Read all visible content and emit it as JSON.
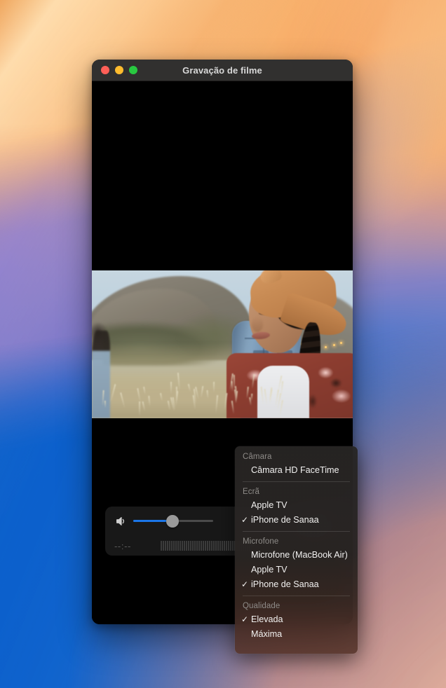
{
  "window": {
    "title": "Gravação de filme",
    "traffic_lights": [
      {
        "name": "close",
        "color": "#ff5f57"
      },
      {
        "name": "minimize",
        "color": "#febc2e"
      },
      {
        "name": "maximize",
        "color": "#28c840"
      }
    ]
  },
  "controls": {
    "speaker_icon": "speaker-icon",
    "volume_percent": 48,
    "record_icon": "record-icon",
    "record_color": "#e02b26",
    "timecode": "--:--",
    "level_meter_bars": 56,
    "accent_color": "#1b76e8"
  },
  "popup_menu": {
    "sections": [
      {
        "title": "Câmara",
        "items": [
          {
            "label": "Câmara HD FaceTime",
            "checked": false
          }
        ]
      },
      {
        "title": "Ecrã",
        "items": [
          {
            "label": "Apple TV",
            "checked": false
          },
          {
            "label": "iPhone de Sanaa",
            "checked": true
          }
        ]
      },
      {
        "title": "Microfone",
        "items": [
          {
            "label": "Microfone (MacBook Air)",
            "checked": false
          },
          {
            "label": "Apple TV",
            "checked": false
          },
          {
            "label": "iPhone de Sanaa",
            "checked": true
          }
        ]
      },
      {
        "title": "Qualidade",
        "items": [
          {
            "label": "Elevada",
            "checked": true
          },
          {
            "label": "Máxima",
            "checked": false
          }
        ]
      }
    ],
    "check_glyph": "✓"
  }
}
